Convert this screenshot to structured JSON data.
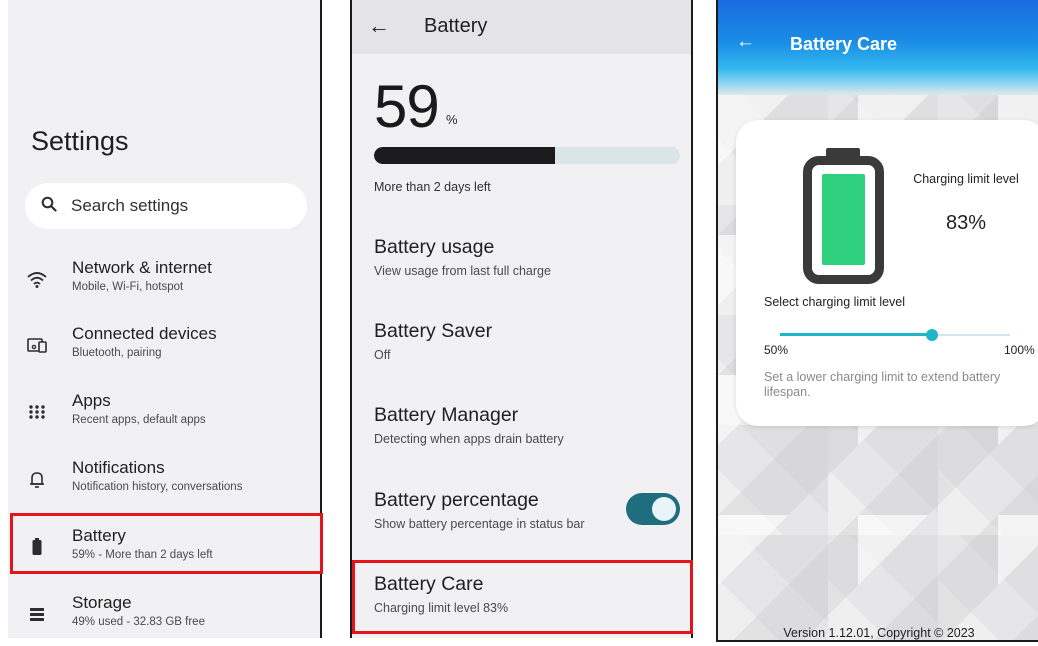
{
  "settings": {
    "title": "Settings",
    "search_label": "Search settings",
    "items": [
      {
        "icon": "wifi-icon",
        "title": "Network & internet",
        "subtitle": "Mobile, Wi-Fi, hotspot"
      },
      {
        "icon": "devices-icon",
        "title": "Connected devices",
        "subtitle": "Bluetooth, pairing"
      },
      {
        "icon": "apps-grid-icon",
        "title": "Apps",
        "subtitle": "Recent apps, default apps"
      },
      {
        "icon": "bell-icon",
        "title": "Notifications",
        "subtitle": "Notification history, conversations"
      },
      {
        "icon": "battery-icon",
        "title": "Battery",
        "subtitle": "59% - More than 2 days left"
      },
      {
        "icon": "storage-icon",
        "title": "Storage",
        "subtitle": "49% used - 32.83 GB free"
      }
    ],
    "highlight_color": "#e3141c"
  },
  "battery": {
    "title": "Battery",
    "percent": "59",
    "percent_sign": "%",
    "level_fraction": 0.59,
    "time_left": "More than 2 days left",
    "items": [
      {
        "title": "Battery usage",
        "subtitle": "View usage from last full charge"
      },
      {
        "title": "Battery Saver",
        "subtitle": "Off"
      },
      {
        "title": "Battery Manager",
        "subtitle": "Detecting when apps drain battery"
      },
      {
        "title": "Battery percentage",
        "subtitle": "Show battery percentage in status bar",
        "toggle_on": true
      },
      {
        "title": "Battery Care",
        "subtitle": "Charging limit level 83%"
      }
    ],
    "toggle_color": "#1e6e80"
  },
  "battery_care": {
    "title": "Battery Care",
    "charging_limit_label": "Charging limit level",
    "charging_limit_value": "83%",
    "select_label": "Select charging limit level",
    "slider_min": "50%",
    "slider_max": "100%",
    "slider_value": 83,
    "slider_min_value": 50,
    "slider_max_value": 100,
    "description": "Set a lower charging limit to extend battery lifespan.",
    "footer": "Version 1.12.01, Copyright © 2023",
    "battery_fill_color": "#2ecf7d",
    "accent_color": "#1eb5c9",
    "header_color": "#1b6ae0"
  }
}
